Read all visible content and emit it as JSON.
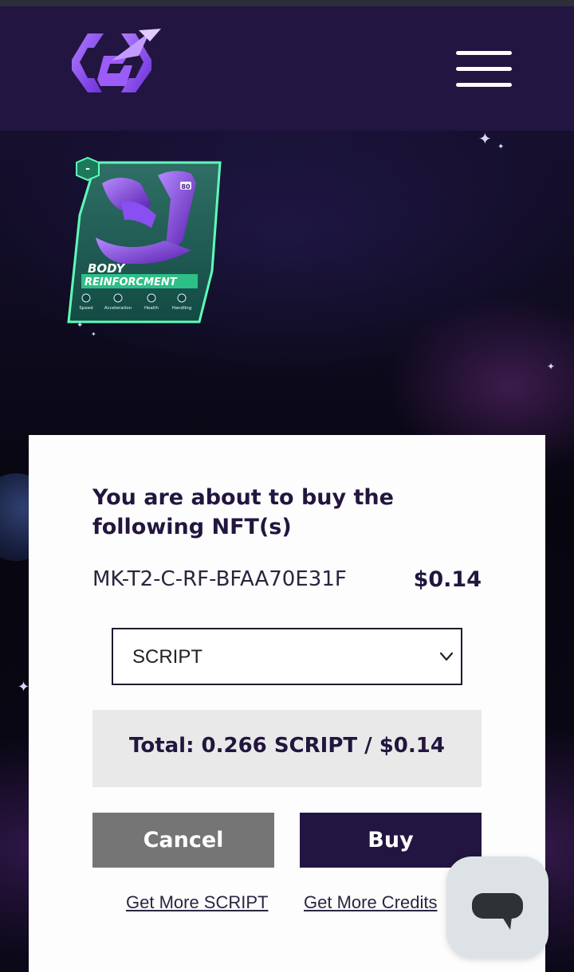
{
  "header": {
    "menu_icon": "hamburger-menu-icon",
    "logo_icon": "rocket-logo-icon",
    "background": "#231541"
  },
  "nft_card": {
    "badge": "-",
    "title_line1": "BODY",
    "title_line2": "REINFORCMENT",
    "level": "80",
    "stats": [
      "Speed",
      "Acceleration",
      "Health",
      "Handling"
    ]
  },
  "modal": {
    "title": "You are about to buy the following NFT(s)",
    "nft_id": "MK-T2-C-RF-BFAA70E31F",
    "nft_price": "$0.14",
    "currency_select": {
      "value": "SCRIPT"
    },
    "total": "Total: 0.266 SCRIPT / $0.14",
    "cancel_label": "Cancel",
    "buy_label": "Buy",
    "link_script": "Get More SCRIPT",
    "link_credits": "Get More Credits"
  },
  "colors": {
    "accent": "#231541",
    "cancel": "#757575",
    "card_green": "#3fe39a",
    "purple": "#8a3ff2"
  },
  "chat": {
    "icon": "chat-bubble-icon"
  }
}
